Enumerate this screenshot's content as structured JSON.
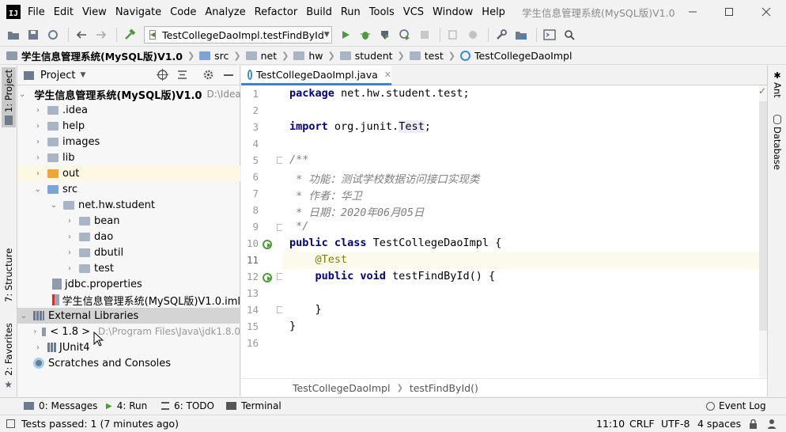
{
  "menubar": {
    "logo": "IJ",
    "items": [
      "File",
      "Edit",
      "View",
      "Navigate",
      "Code",
      "Analyze",
      "Refactor",
      "Build",
      "Run",
      "Tools",
      "VCS",
      "Window",
      "Help"
    ],
    "window_title": "学生信息管理系统(MySQL版)V1.0"
  },
  "toolbar": {
    "run_config": "TestCollegeDaoImpl.testFindById"
  },
  "navbar": {
    "crumbs": [
      "学生信息管理系统(MySQL版)V1.0",
      "src",
      "net",
      "hw",
      "student",
      "test",
      "TestCollegeDaoImpl"
    ]
  },
  "left_stripe": {
    "project_tab": "1: Project",
    "structure_tab": "7: Structure",
    "favorites_tab": "2: Favorites"
  },
  "project": {
    "header": "Project",
    "rows": [
      {
        "label": "学生信息管理系统(MySQL版)V1.0",
        "extra": "D:\\IdeaP",
        "arrow": "v"
      },
      {
        "label": ".idea",
        "extra": "",
        "arrow": ">"
      },
      {
        "label": "help",
        "extra": "",
        "arrow": ">"
      },
      {
        "label": "images",
        "extra": "",
        "arrow": ">"
      },
      {
        "label": "lib",
        "extra": "",
        "arrow": ">"
      },
      {
        "label": "out",
        "extra": "",
        "arrow": ">"
      },
      {
        "label": "src",
        "extra": "",
        "arrow": "v"
      },
      {
        "label": "net.hw.student",
        "extra": "",
        "arrow": "v"
      },
      {
        "label": "bean",
        "extra": "",
        "arrow": ">"
      },
      {
        "label": "dao",
        "extra": "",
        "arrow": ">"
      },
      {
        "label": "dbutil",
        "extra": "",
        "arrow": ">"
      },
      {
        "label": "test",
        "extra": "",
        "arrow": ">"
      },
      {
        "label": "jdbc.properties",
        "extra": "",
        "arrow": ""
      },
      {
        "label": "学生信息管理系统(MySQL版)V1.0.iml",
        "extra": "",
        "arrow": ""
      },
      {
        "label": "External Libraries",
        "extra": "",
        "arrow": "v"
      },
      {
        "label": "< 1.8 >",
        "extra": "D:\\Program Files\\Java\\jdk1.8.0",
        "arrow": ">"
      },
      {
        "label": "JUnit4",
        "extra": "",
        "arrow": ">"
      },
      {
        "label": "Scratches and Consoles",
        "extra": "",
        "arrow": ""
      }
    ]
  },
  "editor": {
    "tab": "TestCollegeDaoImpl.java",
    "line_numbers": [
      "1",
      "2",
      "3",
      "4",
      "5",
      "6",
      "7",
      "8",
      "9",
      "10",
      "11",
      "12",
      "13",
      "14",
      "15",
      "16"
    ],
    "lines": {
      "l1_kw": "package",
      "l1_rest": " net.hw.student.test;",
      "l3_kw": "import",
      "l3_rest": " org.junit.",
      "l3_hl": "Test",
      "l3_end": ";",
      "l5": "/**",
      "l6": " * 功能：测试学校数据访问接口实现类",
      "l7": " * 作者：华卫",
      "l8": " * 日期：2020年06月05日",
      "l9": " */",
      "l10_kw": "public class",
      "l10_rest": " TestCollegeDaoImpl {",
      "l11": "    @Test",
      "l12_pre": "    ",
      "l12_kw": "public void",
      "l12_rest": " testFindById() {",
      "l14": "    }",
      "l15": "}"
    },
    "breadcrumb": [
      "TestCollegeDaoImpl",
      "testFindById()"
    ]
  },
  "right_stripe": {
    "ant": "Ant",
    "database": "Database"
  },
  "bottom_tools": {
    "messages": "0: Messages",
    "run": "4: Run",
    "todo": "6: TODO",
    "terminal": "Terminal",
    "event_log": "Event Log"
  },
  "status": {
    "message": "Tests passed: 1 (7 minutes ago)",
    "position": "11:10",
    "line_sep": "CRLF",
    "encoding": "UTF-8",
    "indent": "4 spaces"
  },
  "colors": {
    "keyword": "#000080",
    "comment": "#808080",
    "annotation": "#808000",
    "current_line": "#fcfaed",
    "selected_row": "#d4d4d4",
    "highlight_row": "#fdf8e3"
  }
}
